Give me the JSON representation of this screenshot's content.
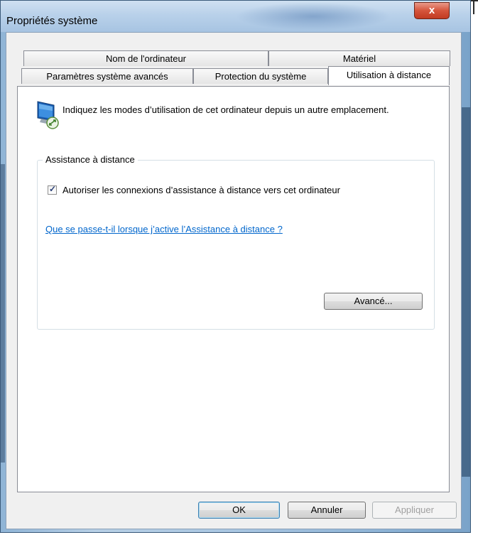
{
  "window": {
    "title": "Propriétés système",
    "close_glyph": "x"
  },
  "tabs_row1": [
    {
      "label": "Nom de l'ordinateur"
    },
    {
      "label": "Matériel"
    }
  ],
  "tabs_row2": [
    {
      "label": "Paramètres système avancés"
    },
    {
      "label": "Protection du système"
    },
    {
      "label": "Utilisation à distance"
    }
  ],
  "page": {
    "intro": "Indiquez les modes d’utilisation de cet ordinateur depuis un autre emplacement.",
    "group_title": "Assistance à distance",
    "checkbox_label": "Autoriser les connexions d’assistance à distance vers cet ordinateur",
    "checkbox_checked": true,
    "help_link": "Que se passe-t-il lorsque j’active l’Assistance à distance ?",
    "advanced_button": "Avancé..."
  },
  "footer": {
    "ok": "OK",
    "cancel": "Annuler",
    "apply": "Appliquer"
  },
  "icons": {
    "computer": "remote-computer-icon"
  },
  "colors": {
    "link": "#0066cc",
    "close_button": "#c13a22",
    "title_bar": "#b9d1ea"
  }
}
